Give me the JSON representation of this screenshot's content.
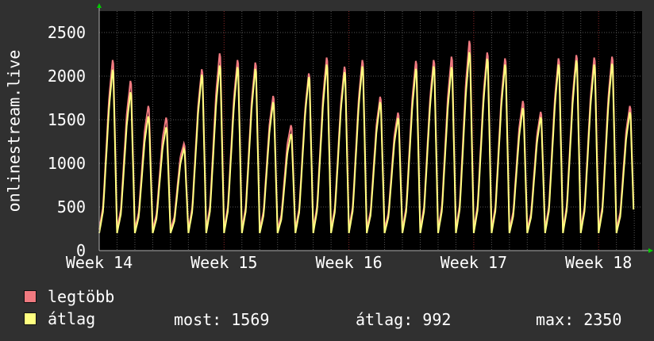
{
  "chart_data": {
    "type": "line",
    "ylabel": "onlinestream.live",
    "yticks": [
      0,
      500,
      1000,
      1500,
      2000,
      2500
    ],
    "ytick_labels": [
      "0",
      "500",
      "1000",
      "1500",
      "2000",
      "2500"
    ],
    "ylim": [
      0,
      2500
    ],
    "xticks": [
      "Week 14",
      "Week 15",
      "Week 16",
      "Week 17",
      "Week 18"
    ],
    "grid": true,
    "days": 35,
    "daily_peaks_max": [
      2250,
      2000,
      1700,
      1560,
      1250,
      2140,
      2330,
      2250,
      2220,
      1820,
      1470,
      2090,
      2280,
      2170,
      2250,
      1810,
      1620,
      2240,
      2250,
      2290,
      2480,
      2340,
      2270,
      1760,
      1630,
      2270,
      2310,
      2280,
      2290,
      1700
    ],
    "daily_peaks_avg": [
      2140,
      1870,
      1580,
      1450,
      1190,
      2080,
      2190,
      2170,
      2150,
      1750,
      1370,
      2050,
      2200,
      2110,
      2180,
      1750,
      1560,
      2150,
      2180,
      2170,
      2350,
      2270,
      2200,
      1680,
      1570,
      2200,
      2250,
      2200,
      2210,
      1630
    ],
    "series": [
      {
        "name": "legtöbb",
        "color": "#f07a80"
      },
      {
        "name": "átlag",
        "color": "#ffff80"
      }
    ]
  },
  "legend": {
    "max_label": "legtöbb",
    "avg_label": "átlag"
  },
  "stats": {
    "current": "most: 1569",
    "average": "átlag: 992",
    "maximum": "max: 2350"
  },
  "colors": {
    "background": "#303030",
    "plot_background": "#000000",
    "grid": "#555555",
    "week_grid": "#8b2a2a",
    "axis": "#b0b0b0",
    "arrow": "#00cc00"
  }
}
